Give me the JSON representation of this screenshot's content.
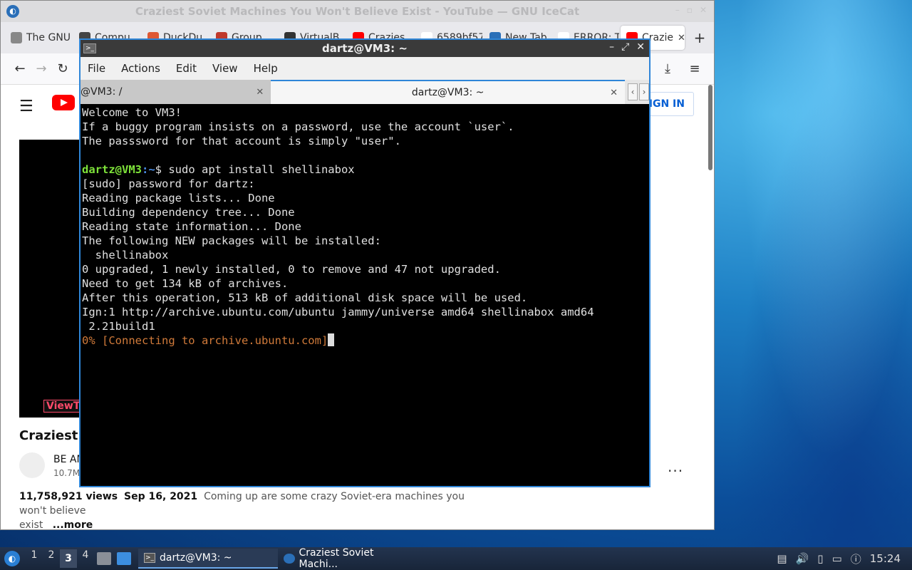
{
  "browser": {
    "title": "Craziest Soviet Machines You Won't Believe Exist - YouTube — GNU IceCat",
    "tabs": [
      {
        "label": "The GNU",
        "color": "#888888"
      },
      {
        "label": "Compu",
        "color": "#444444"
      },
      {
        "label": "DuckDu",
        "color": "#de5833"
      },
      {
        "label": "Group",
        "color": "#c0392b"
      },
      {
        "label": "VirtualB",
        "color": "#333333"
      },
      {
        "label": "Crazies",
        "color": "#ff0000"
      },
      {
        "label": "6589bf57",
        "color": "#ffffff"
      },
      {
        "label": "New Tab",
        "color": "#2a6fb8"
      },
      {
        "label": "ERROR: Th",
        "color": "#ffffff"
      },
      {
        "label": "Crazie",
        "color": "#ff0000",
        "active": true
      }
    ],
    "new_tab_label": "+"
  },
  "youtube": {
    "signin_label": "SIGN IN",
    "video_tag": "ViewT",
    "video_title": "Craziest So",
    "channel_name": "BE AM",
    "subscribers": "10.7M",
    "more_dots": "...",
    "views": "11,758,921 views",
    "date": "Sep 16, 2021",
    "description_line1": "Coming up are some crazy Soviet-era machines you won't believe",
    "description_line2": "exist",
    "more_label": "...more"
  },
  "terminal": {
    "title": "dartz@VM3: ~",
    "menu": [
      "File",
      "Actions",
      "Edit",
      "View",
      "Help"
    ],
    "tab_inactive": "@VM3: /",
    "tab_active": "dartz@VM3: ~",
    "lines_before": "Welcome to VM3!\nIf a buggy program insists on a password, use the account `user`.\nThe passsword for that account is simply \"user\".\n",
    "prompt_user": "dartz@VM3",
    "prompt_path": ":~",
    "command": "$ sudo apt install shellinabox",
    "output": "[sudo] password for dartz:\nReading package lists... Done\nBuilding dependency tree... Done\nReading state information... Done\nThe following NEW packages will be installed:\n  shellinabox\n0 upgraded, 1 newly installed, 0 to remove and 47 not upgraded.\nNeed to get 134 kB of archives.\nAfter this operation, 513 kB of additional disk space will be used.\nIgn:1 http://archive.ubuntu.com/ubuntu jammy/universe amd64 shellinabox amd64\n 2.21build1",
    "progress_line": "0% [Connecting to archive.ubuntu.com]"
  },
  "taskbar": {
    "workspaces": [
      "1",
      "2",
      "3",
      "4"
    ],
    "active_workspace": "3",
    "tasks": [
      {
        "label": "dartz@VM3: ~",
        "active": true
      },
      {
        "label": "Craziest Soviet Machi...",
        "active": false
      }
    ],
    "clock": "15:24"
  },
  "colors": {
    "accent": "#2f86d8",
    "prompt_user": "#7ee23a",
    "prompt_path": "#4b8ee8",
    "progress_text": "#d07a3a",
    "youtube_red": "#ff0000"
  }
}
